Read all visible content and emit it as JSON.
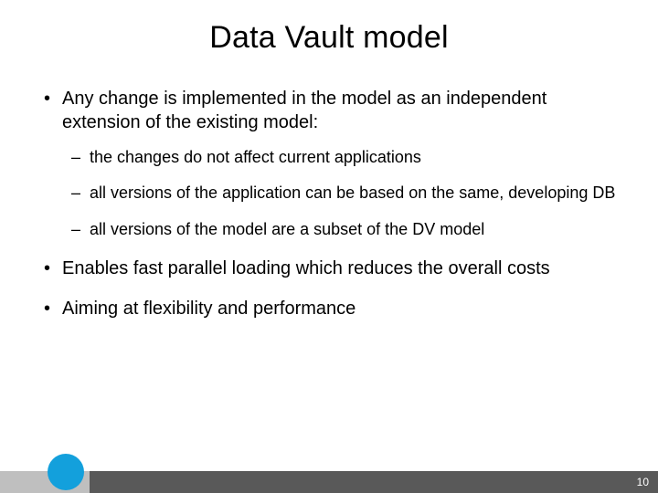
{
  "slide": {
    "title": "Data Vault model",
    "bullets": [
      {
        "text": "Any change is implemented in the model as an independent extension of the existing model:",
        "sub": [
          "the changes do not affect current applications",
          "all versions of the application can be based on the same, developing DB",
          "all versions of the model are a subset of the DV model"
        ]
      },
      {
        "text": "Enables fast parallel loading which reduces the overall costs",
        "sub": []
      },
      {
        "text": "Aiming at flexibility and performance",
        "sub": []
      }
    ],
    "page_number": "10"
  },
  "colors": {
    "footer_dark": "#595959",
    "footer_light": "#bfbfbf",
    "accent_circle": "#13a0dc"
  }
}
